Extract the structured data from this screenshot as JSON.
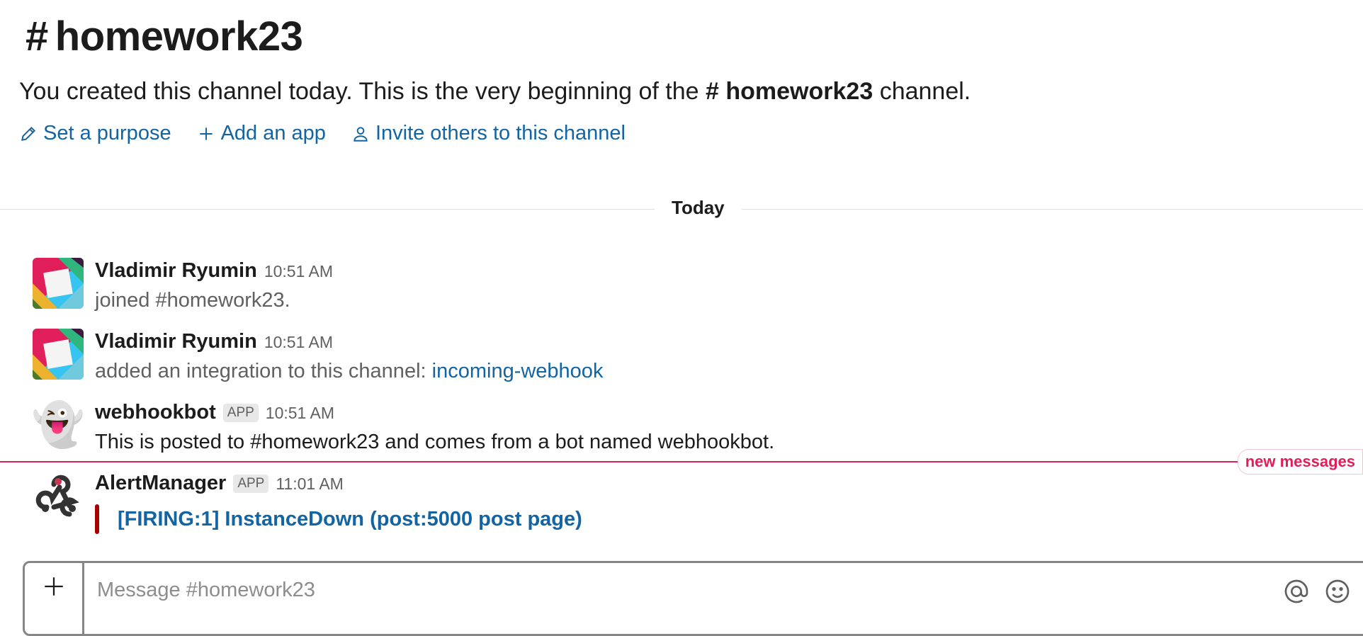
{
  "channel": {
    "hash": "#",
    "name": "homework23"
  },
  "intro": {
    "prefix": "You created this channel today. This is the very beginning of the",
    "channel_ref": "# homework23",
    "suffix": "channel."
  },
  "actions": {
    "set_purpose": "Set a purpose",
    "add_app": "Add an app",
    "invite": "Invite others to this channel"
  },
  "day_divider": "Today",
  "messages": [
    {
      "sender": "Vladimir Ryumin",
      "time": "10:51 AM",
      "text": "joined #homework23."
    },
    {
      "sender": "Vladimir Ryumin",
      "time": "10:51 AM",
      "text": "added an integration to this channel:",
      "link": "incoming-webhook"
    },
    {
      "sender": "webhookbot",
      "badge": "APP",
      "time": "10:51 AM",
      "text": "This is posted to #homework23 and comes from a bot named webhookbot.",
      "avatar_emoji": "👻"
    },
    {
      "sender": "AlertManager",
      "badge": "APP",
      "time": "11:01 AM",
      "attachment_title": "[FIRING:1] InstanceDown (post:5000 post page)",
      "attachment_color": "#a30200"
    }
  ],
  "new_messages_label": "new messages",
  "composer": {
    "placeholder": "Message #homework23"
  },
  "colors": {
    "link": "#1264a3",
    "new_messages": "#e01e5a"
  }
}
